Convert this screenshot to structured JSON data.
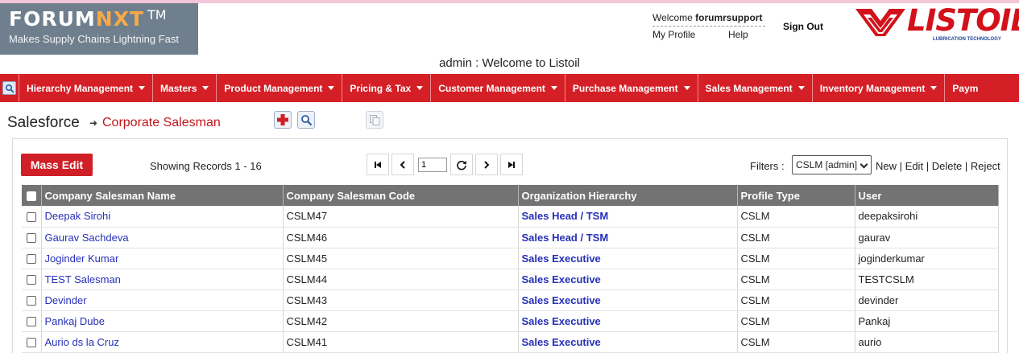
{
  "header": {
    "logo": {
      "name_main": "FORUM",
      "name_accent": "NXT",
      "trademark": "TM",
      "tagline": "Makes Supply Chains Lightning Fast"
    },
    "welcome_prefix": "Welcome",
    "username": "forumrsupport",
    "my_profile": "My Profile",
    "help": "Help",
    "sign_out": "Sign Out",
    "brand": {
      "name": "LISTOIL",
      "registered": "®",
      "tagline": "LUBRICATION TECHNOLOGY",
      "color": "#d3111a"
    },
    "center_title": "admin : Welcome to Listoil"
  },
  "nav": {
    "search_icon": "search-icon",
    "items": [
      {
        "label": "Hierarchy Management"
      },
      {
        "label": "Masters"
      },
      {
        "label": "Product Management"
      },
      {
        "label": "Pricing & Tax"
      },
      {
        "label": "Customer Management"
      },
      {
        "label": "Purchase Management"
      },
      {
        "label": "Sales Management"
      },
      {
        "label": "Inventory Management"
      },
      {
        "label": "Paym"
      }
    ],
    "color": "#d51f26"
  },
  "breadcrumb": {
    "root": "Salesforce",
    "separator": "➜",
    "current": "Corporate Salesman"
  },
  "toolbar": {
    "add_icon": "plus-icon",
    "search_icon": "search-icon",
    "disabled_icon": "copy-icon"
  },
  "grid": {
    "mass_edit": "Mass Edit",
    "records": "Showing Records 1 - 16",
    "pager": {
      "first": "first-page-icon",
      "prev": "prev-page-icon",
      "page": "1",
      "refresh": "refresh-icon",
      "next": "next-page-icon",
      "last": "last-page-icon"
    },
    "filters_label": "Filters :",
    "filter_value": "CSLM [admin]",
    "actions": [
      "New",
      "Edit",
      "Delete",
      "Reject"
    ],
    "action_separator": "|",
    "columns": [
      "Company Salesman Name",
      "Company Salesman Code",
      "Organization Hierarchy",
      "Profile Type",
      "User"
    ],
    "rows": [
      [
        "Deepak Sirohi",
        "CSLM47",
        "Sales Head / TSM",
        "CSLM",
        "deepaksirohi"
      ],
      [
        "Gaurav Sachdeva",
        "CSLM46",
        "Sales Head / TSM",
        "CSLM",
        "gaurav"
      ],
      [
        "Joginder Kumar",
        "CSLM45",
        "Sales Executive",
        "CSLM",
        "joginderkumar"
      ],
      [
        "TEST Salesman",
        "CSLM44",
        "Sales Executive",
        "CSLM",
        "TESTCSLM"
      ],
      [
        "Devinder",
        "CSLM43",
        "Sales Executive",
        "CSLM",
        "devinder"
      ],
      [
        "Pankaj Dube",
        "CSLM42",
        "Sales Executive",
        "CSLM",
        "Pankaj"
      ],
      [
        "Aurio ds la Cruz",
        "CSLM41",
        "Sales Executive",
        "CSLM",
        "aurio"
      ]
    ]
  }
}
